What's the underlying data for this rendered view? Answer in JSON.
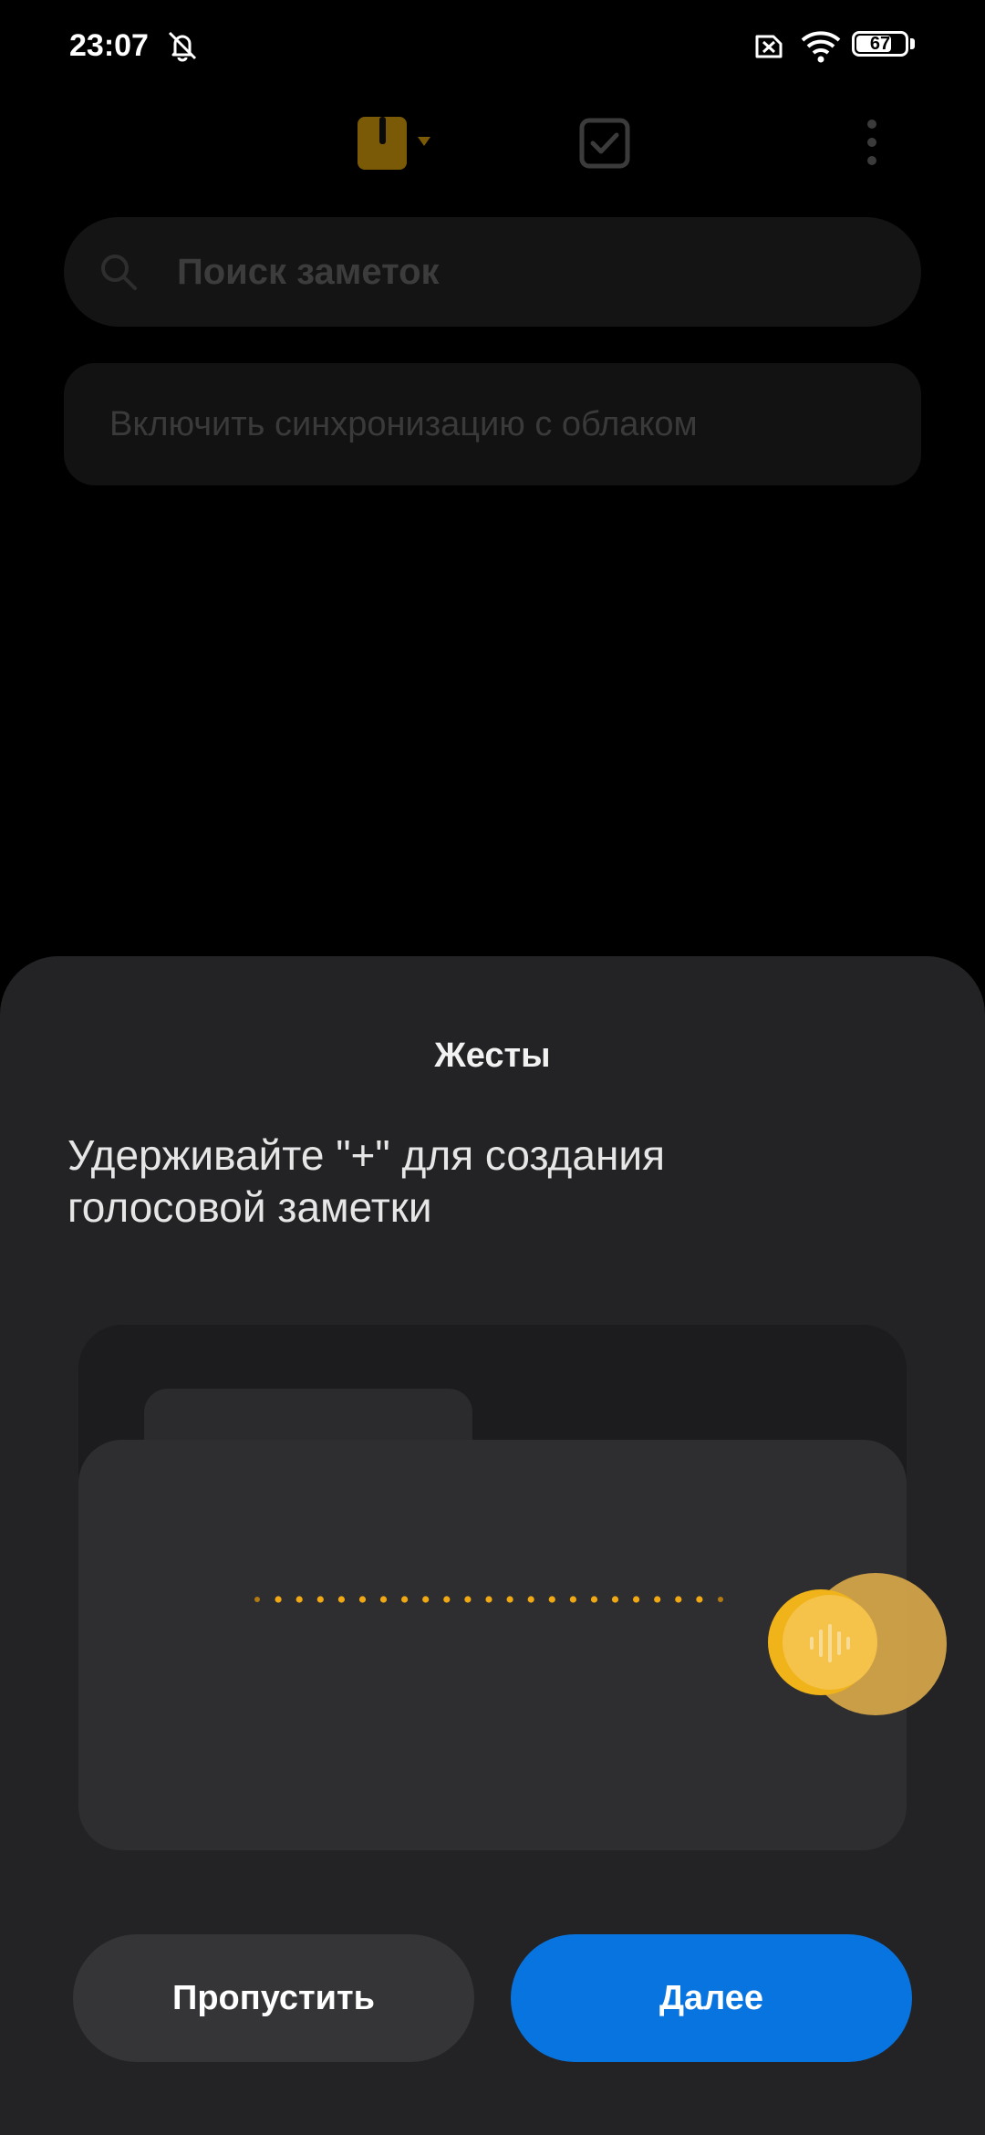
{
  "status_bar": {
    "time": "23:07",
    "battery_level": "67",
    "icons": [
      "bell-muted-icon",
      "sim-off-icon",
      "wifi-icon",
      "battery-icon"
    ]
  },
  "toolbar": {
    "icons": [
      "notes-icon",
      "tasks-checkbox-icon",
      "more-vertical-icon"
    ],
    "accent_color": "#ffb700"
  },
  "search": {
    "placeholder": "Поиск заметок"
  },
  "sync_banner": {
    "text": "Включить синхронизацию с облаком"
  },
  "gesture_sheet": {
    "title": "Жесты",
    "description": "Удерживайте \"+\" для создания голосовой заметки",
    "illustration_icons": [
      "voice-wave-icon",
      "voice-record-fab-icon"
    ]
  },
  "buttons": {
    "skip": "Пропустить",
    "next": "Далее",
    "next_color": "#0874e0"
  }
}
